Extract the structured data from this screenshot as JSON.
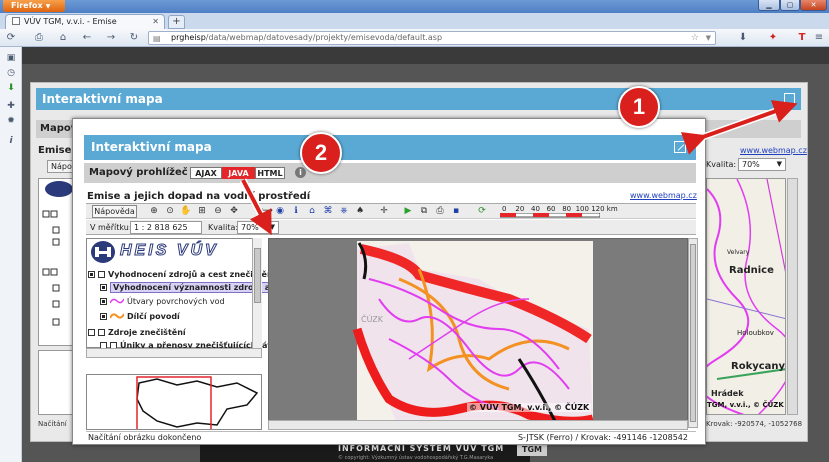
{
  "browser": {
    "app_button": "Firefox",
    "tab_title": "VÚV TGM, v.v.i. - Emise",
    "url_host": "prgheisp",
    "url_path": "/data/webmap/datovesady/projekty/emisevoda/default.asp",
    "new_tab": "+"
  },
  "background_page": {
    "header": "Interaktivní mapa",
    "mapovy": "Mapový",
    "emise": "Emise",
    "napoveda": "Nápov",
    "link": "www.webmap.cz",
    "kvalita_label": "Kvalita:",
    "kvalita_value": "70%",
    "place_labels": [
      "Velvary",
      "Radnice",
      "Holoubkov",
      "Rokycany",
      "Hrádek"
    ],
    "copyright": "TGM, v.v.i., © ČÚZK",
    "status_left": "Načítání",
    "status_right": "Krovak: -920574, -1052768"
  },
  "popup": {
    "header": "Interaktivní mapa",
    "viewer_label": "Mapový prohlížeč",
    "modes": [
      "AJAX",
      "JAVA",
      "HTML"
    ],
    "active_mode": "JAVA",
    "title": "Emise a jejich dopad na vodní prostředí",
    "link": "www.webmap.cz",
    "help_button": "Nápověda",
    "scale_label": "V měřítku:",
    "scale_value": "1 : 2 818 625",
    "quality_label": "Kvalita:",
    "quality_value": "70%",
    "scale_ticks": [
      "0",
      "20",
      "40",
      "60",
      "80",
      "100",
      "120 km"
    ],
    "logo_text": "HEIS VÚV",
    "legend": [
      "Vyhodnocení zdrojů a cest znečištění v p",
      "Vyhodnocení významnosti zdrojů a ce",
      "Útvary povrchových vod",
      "Dílčí povodí",
      "Zdroje znečištění",
      "Úniky a přenosy znečišťujících látek"
    ],
    "map_watermark": "ČÚZK",
    "map_copyright": "© VÚV TGM, v.v.i., © ČÚZK",
    "status_text": "Načítání obrázku dokončeno",
    "coords": "S-JTSK (Ferro) / Krovak: -491146 -1208542"
  },
  "footer": {
    "text": "INFORMAČNÍ SYSTÉM VÚV TGM",
    "subtext": "© copyright: Výzkumný ústav vodohospodářský T.G.Masaryka",
    "logo": "TGM"
  },
  "annotations": [
    "1",
    "2"
  ],
  "colors": {
    "header_blue": "#5aa9d4",
    "java_red": "#e4262b",
    "annotation_red": "#d9201c",
    "river_magenta": "#e23df0",
    "border_red": "#ee1c1c",
    "basin_orange": "#f39223"
  }
}
